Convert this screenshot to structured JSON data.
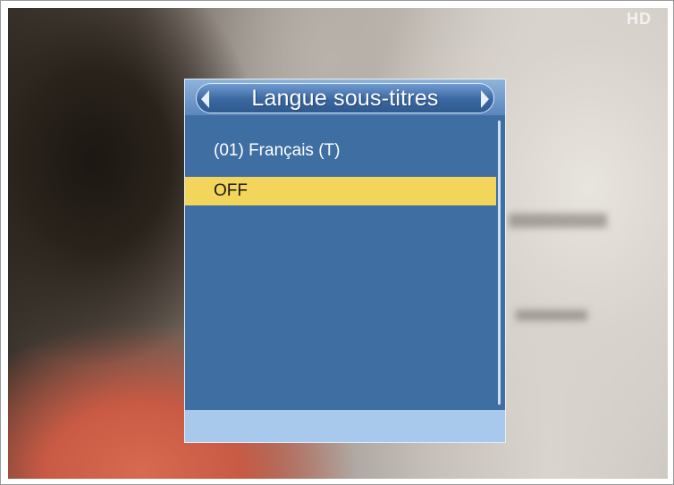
{
  "channel_logo": "HD",
  "dialog": {
    "title": "Langue sous-titres",
    "items": [
      {
        "label": "(01)  Français (T)",
        "selected": false
      },
      {
        "label": "OFF",
        "selected": true
      }
    ]
  },
  "colors": {
    "dialog_background": "#3f6ea3",
    "highlight": "#f3d55b",
    "footer": "#a8c9ec"
  }
}
